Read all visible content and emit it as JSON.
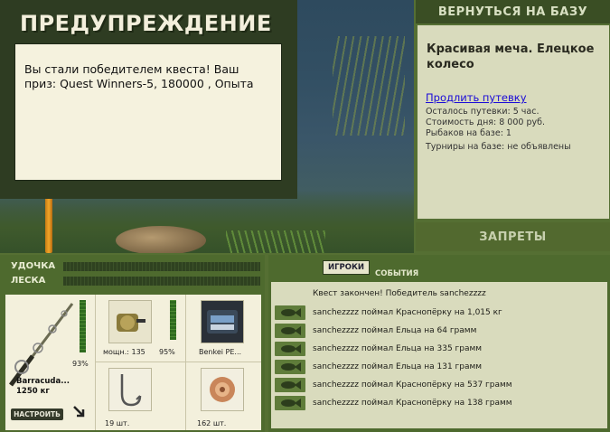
{
  "warning": {
    "title": "ПРЕДУПРЕЖДЕНИЕ",
    "message": "Вы стали победителем квеста! Ваш приз: Quest Winners-5, 180000 , Опыта"
  },
  "right_panel": {
    "return_button": "ВЕРНУТЬСЯ НА БАЗУ",
    "base_name": "Красивая меча. Елецкое колесо",
    "renew_link": "Продлить путевку",
    "stats": [
      "Осталось путевки: 5 час.",
      "Стоимость дня: 8 000 руб.",
      "Рыбаков на базе: 1",
      "Турниры на базе: не объявлены"
    ],
    "bans_button": "ЗАПРЕТЫ"
  },
  "tackle": {
    "rod_label": "УДОЧКА",
    "line_label": "ЛЕСКА",
    "rod": {
      "name": "Barracuda...",
      "weight": "1250 кг",
      "percent": "93%",
      "condition": 0.93
    },
    "setup_button": "НАСТРОИТЬ",
    "reel": {
      "power": "мощн.: 135",
      "percent": "95%",
      "condition": 0.95
    },
    "line_item": {
      "name": "Benkei PE..."
    },
    "hooks": {
      "count": "19 шт."
    },
    "bait": {
      "count": "162 шт."
    }
  },
  "events": {
    "tab_players": "ИГРОКИ",
    "tab_events": "СОБЫТИЯ",
    "quest_message": "Квест закончен! Победитель sanchezzzz",
    "catches": [
      "sanchezzzz поймал Краснопёрку на 1,015 кг",
      "sanchezzzz поймал Ельца на 64 грамм",
      "sanchezzzz поймал Ельца на 335 грамм",
      "sanchezzzz поймал Ельца на 131 грамм",
      "sanchezzzz поймал Краснопёрку на 537 грамм",
      "sanchezzzz поймал Краснопёрку на 138 грамм"
    ]
  }
}
